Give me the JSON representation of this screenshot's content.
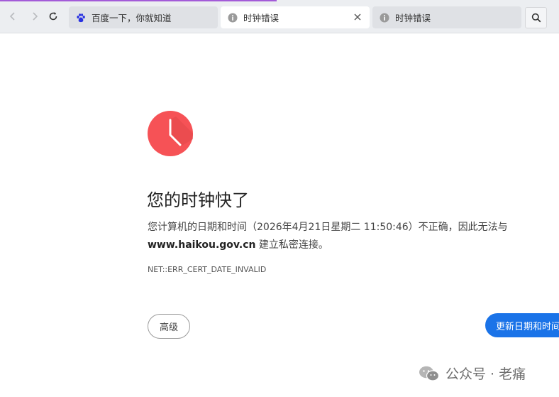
{
  "browser": {
    "tabs": [
      {
        "label": "百度一下，你就知道",
        "icon": "baidu-paw-icon",
        "active": false
      },
      {
        "label": "时钟错误",
        "icon": "info-icon",
        "active": true
      },
      {
        "label": "时钟错误",
        "icon": "info-icon",
        "active": false
      }
    ],
    "accent_color": "#a35bd8"
  },
  "error_page": {
    "icon": "clock-icon",
    "icon_color": "#f65256",
    "title": "您的时钟快了",
    "description_line1": "您计算机的日期和时间（2026年4月21日星期二 11:50:46）不正确，因此无法与",
    "host": "www.haikou.gov.cn",
    "description_line2_suffix": " 建立私密连接。",
    "error_code": "NET::ERR_CERT_DATE_INVALID",
    "advanced_button": "高级",
    "primary_button": "更新日期和时间",
    "primary_color": "#1a73e8"
  },
  "watermark": {
    "text": "公众号 · 老痛",
    "icon": "wechat-icon"
  }
}
